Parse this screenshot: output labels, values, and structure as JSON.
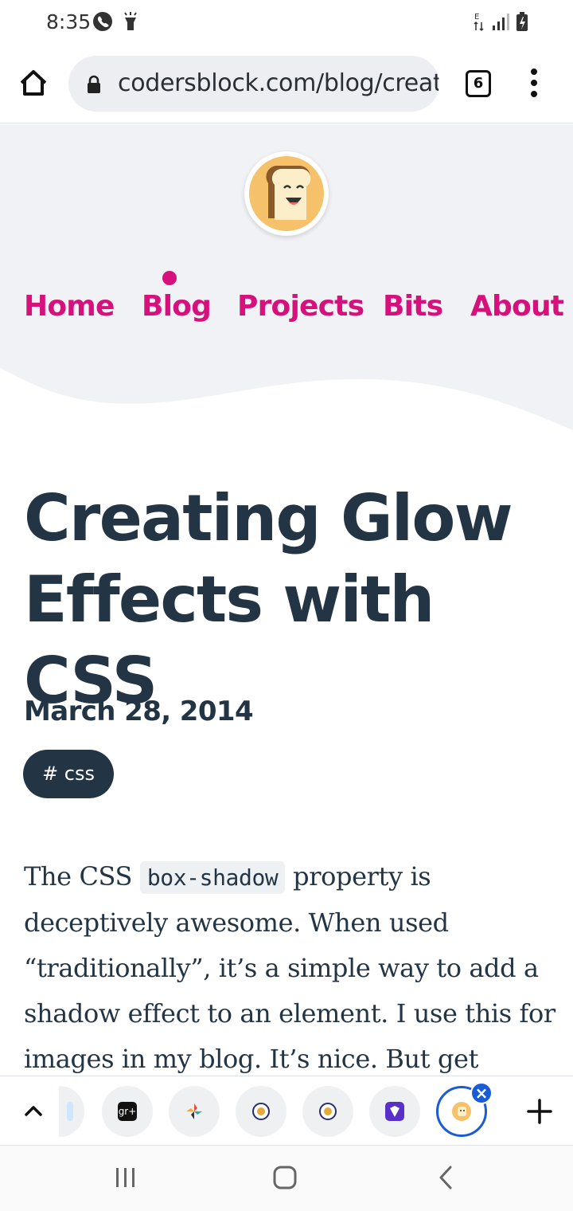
{
  "status_bar": {
    "time": "8:35"
  },
  "browser": {
    "url": "codersblock.com/blog/creat",
    "tab_count": "6"
  },
  "nav": {
    "items": [
      {
        "label": "Home"
      },
      {
        "label": "Blog"
      },
      {
        "label": "Projects"
      },
      {
        "label": "Bits"
      },
      {
        "label": "About"
      }
    ],
    "active": "Blog"
  },
  "article": {
    "title": "Creating Glow Effects with CSS",
    "date": "March 28, 2014",
    "tag": "# css",
    "intro_1": "The CSS ",
    "code": "box-shadow",
    "intro_2": " property is deceptively awesome. When used “traditionally”, it’s a simple way to add a shadow effect to an element. I use this for images in my blog. It’s nice. But get"
  },
  "tab_strip": {
    "tabs": [
      {
        "icon": "partial-tab-favicon"
      },
      {
        "icon": "gr-plus-favicon",
        "label": "gr+"
      },
      {
        "icon": "pinwheel-favicon"
      },
      {
        "icon": "orb-favicon"
      },
      {
        "icon": "orb-favicon"
      },
      {
        "icon": "purple-shield-favicon"
      },
      {
        "icon": "toast-favicon",
        "active": true
      }
    ]
  },
  "colors": {
    "accent": "#d6117c",
    "text": "#233544",
    "header_bg": "#f0f2f5",
    "active_tab": "#1a5cd6"
  }
}
